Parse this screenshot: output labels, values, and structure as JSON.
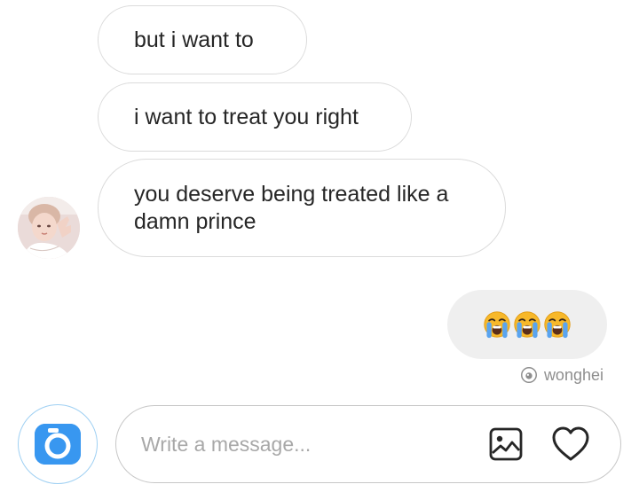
{
  "thread": {
    "contact_avatar_icon": "contact-avatar",
    "messages_in": [
      "but i want to",
      "i want to treat you right",
      "you deserve being treated like a damn prince"
    ],
    "message_out": {
      "emoji": [
        "loudly-crying-face",
        "loudly-crying-face",
        "loudly-crying-face"
      ]
    },
    "seen": {
      "icon": "eye-icon",
      "username": "wonghei"
    }
  },
  "composer": {
    "camera_icon": "camera-icon",
    "placeholder": "Write a message...",
    "value": "",
    "gallery_icon": "image-icon",
    "like_icon": "heart-icon"
  },
  "colors": {
    "accent": "#3897f0",
    "bubble_out_bg": "#efefef",
    "bubble_border": "#dbdbdb",
    "muted_text": "#8e8e8e"
  }
}
